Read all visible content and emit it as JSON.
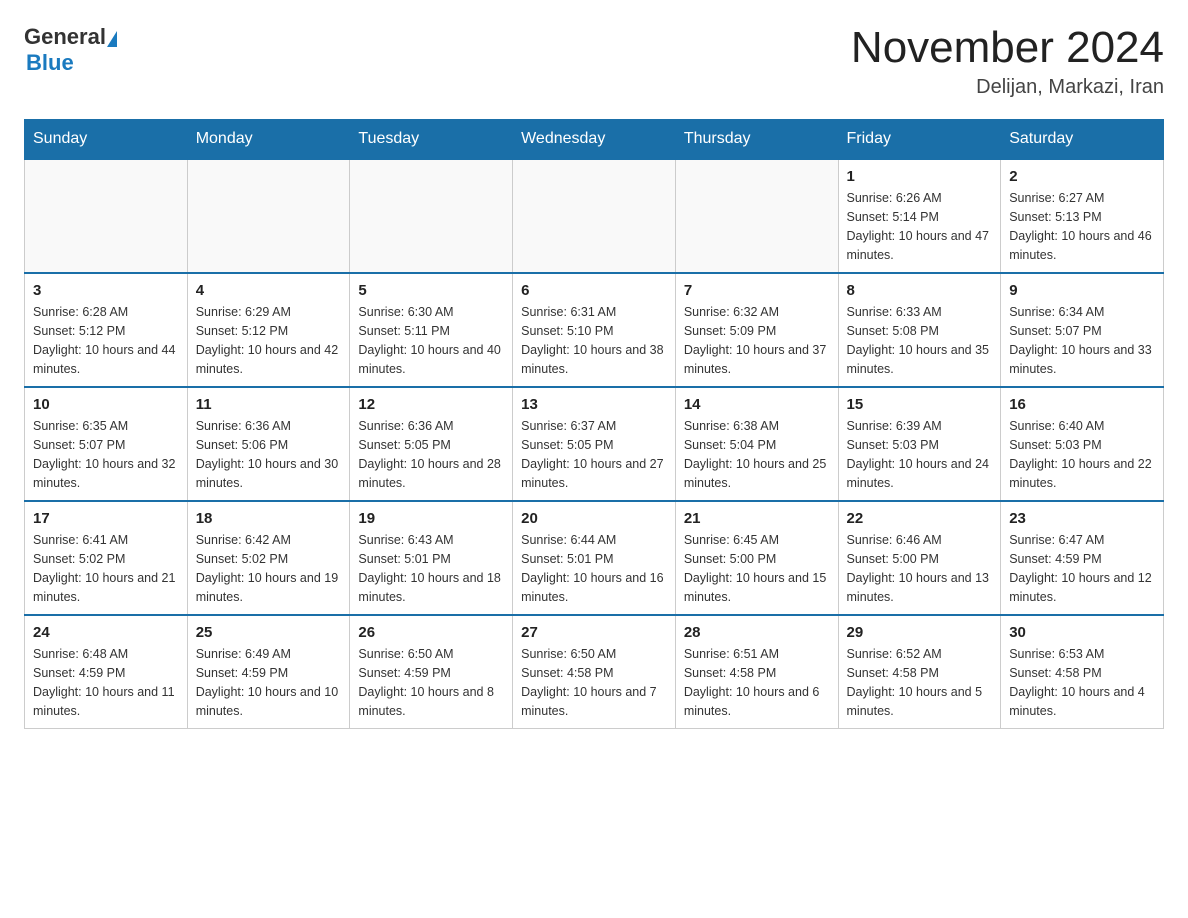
{
  "header": {
    "logo_general": "General",
    "logo_blue": "Blue",
    "month_title": "November 2024",
    "subtitle": "Delijan, Markazi, Iran"
  },
  "weekdays": [
    "Sunday",
    "Monday",
    "Tuesday",
    "Wednesday",
    "Thursday",
    "Friday",
    "Saturday"
  ],
  "weeks": [
    [
      {
        "day": "",
        "info": ""
      },
      {
        "day": "",
        "info": ""
      },
      {
        "day": "",
        "info": ""
      },
      {
        "day": "",
        "info": ""
      },
      {
        "day": "",
        "info": ""
      },
      {
        "day": "1",
        "info": "Sunrise: 6:26 AM\nSunset: 5:14 PM\nDaylight: 10 hours and 47 minutes."
      },
      {
        "day": "2",
        "info": "Sunrise: 6:27 AM\nSunset: 5:13 PM\nDaylight: 10 hours and 46 minutes."
      }
    ],
    [
      {
        "day": "3",
        "info": "Sunrise: 6:28 AM\nSunset: 5:12 PM\nDaylight: 10 hours and 44 minutes."
      },
      {
        "day": "4",
        "info": "Sunrise: 6:29 AM\nSunset: 5:12 PM\nDaylight: 10 hours and 42 minutes."
      },
      {
        "day": "5",
        "info": "Sunrise: 6:30 AM\nSunset: 5:11 PM\nDaylight: 10 hours and 40 minutes."
      },
      {
        "day": "6",
        "info": "Sunrise: 6:31 AM\nSunset: 5:10 PM\nDaylight: 10 hours and 38 minutes."
      },
      {
        "day": "7",
        "info": "Sunrise: 6:32 AM\nSunset: 5:09 PM\nDaylight: 10 hours and 37 minutes."
      },
      {
        "day": "8",
        "info": "Sunrise: 6:33 AM\nSunset: 5:08 PM\nDaylight: 10 hours and 35 minutes."
      },
      {
        "day": "9",
        "info": "Sunrise: 6:34 AM\nSunset: 5:07 PM\nDaylight: 10 hours and 33 minutes."
      }
    ],
    [
      {
        "day": "10",
        "info": "Sunrise: 6:35 AM\nSunset: 5:07 PM\nDaylight: 10 hours and 32 minutes."
      },
      {
        "day": "11",
        "info": "Sunrise: 6:36 AM\nSunset: 5:06 PM\nDaylight: 10 hours and 30 minutes."
      },
      {
        "day": "12",
        "info": "Sunrise: 6:36 AM\nSunset: 5:05 PM\nDaylight: 10 hours and 28 minutes."
      },
      {
        "day": "13",
        "info": "Sunrise: 6:37 AM\nSunset: 5:05 PM\nDaylight: 10 hours and 27 minutes."
      },
      {
        "day": "14",
        "info": "Sunrise: 6:38 AM\nSunset: 5:04 PM\nDaylight: 10 hours and 25 minutes."
      },
      {
        "day": "15",
        "info": "Sunrise: 6:39 AM\nSunset: 5:03 PM\nDaylight: 10 hours and 24 minutes."
      },
      {
        "day": "16",
        "info": "Sunrise: 6:40 AM\nSunset: 5:03 PM\nDaylight: 10 hours and 22 minutes."
      }
    ],
    [
      {
        "day": "17",
        "info": "Sunrise: 6:41 AM\nSunset: 5:02 PM\nDaylight: 10 hours and 21 minutes."
      },
      {
        "day": "18",
        "info": "Sunrise: 6:42 AM\nSunset: 5:02 PM\nDaylight: 10 hours and 19 minutes."
      },
      {
        "day": "19",
        "info": "Sunrise: 6:43 AM\nSunset: 5:01 PM\nDaylight: 10 hours and 18 minutes."
      },
      {
        "day": "20",
        "info": "Sunrise: 6:44 AM\nSunset: 5:01 PM\nDaylight: 10 hours and 16 minutes."
      },
      {
        "day": "21",
        "info": "Sunrise: 6:45 AM\nSunset: 5:00 PM\nDaylight: 10 hours and 15 minutes."
      },
      {
        "day": "22",
        "info": "Sunrise: 6:46 AM\nSunset: 5:00 PM\nDaylight: 10 hours and 13 minutes."
      },
      {
        "day": "23",
        "info": "Sunrise: 6:47 AM\nSunset: 4:59 PM\nDaylight: 10 hours and 12 minutes."
      }
    ],
    [
      {
        "day": "24",
        "info": "Sunrise: 6:48 AM\nSunset: 4:59 PM\nDaylight: 10 hours and 11 minutes."
      },
      {
        "day": "25",
        "info": "Sunrise: 6:49 AM\nSunset: 4:59 PM\nDaylight: 10 hours and 10 minutes."
      },
      {
        "day": "26",
        "info": "Sunrise: 6:50 AM\nSunset: 4:59 PM\nDaylight: 10 hours and 8 minutes."
      },
      {
        "day": "27",
        "info": "Sunrise: 6:50 AM\nSunset: 4:58 PM\nDaylight: 10 hours and 7 minutes."
      },
      {
        "day": "28",
        "info": "Sunrise: 6:51 AM\nSunset: 4:58 PM\nDaylight: 10 hours and 6 minutes."
      },
      {
        "day": "29",
        "info": "Sunrise: 6:52 AM\nSunset: 4:58 PM\nDaylight: 10 hours and 5 minutes."
      },
      {
        "day": "30",
        "info": "Sunrise: 6:53 AM\nSunset: 4:58 PM\nDaylight: 10 hours and 4 minutes."
      }
    ]
  ]
}
